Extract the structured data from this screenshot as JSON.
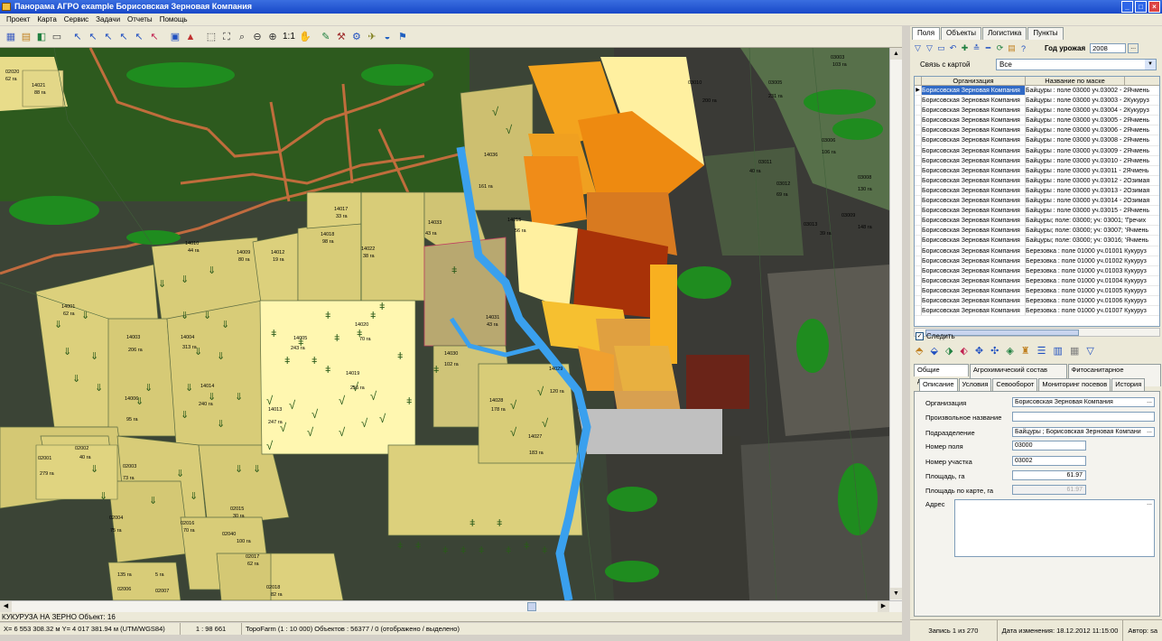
{
  "window": {
    "title": "Панорама АГРО  example   Борисовская Зерновая Компания",
    "min": "_",
    "max": "□",
    "close": "×"
  },
  "menu": [
    "Проект",
    "Карта",
    "Сервис",
    "Задачи",
    "Отчеты",
    "Помощь"
  ],
  "toolbar": {
    "scale_label": "1:1"
  },
  "map": {
    "field_labels": [
      {
        "n": "02020",
        "a": "62 га"
      },
      {
        "n": "14021",
        "a": "88 га"
      },
      {
        "n": "14017",
        "a": "33 га"
      },
      {
        "n": "14010",
        "a": "44 га"
      },
      {
        "n": "14009",
        "a": "80 га"
      },
      {
        "n": "14012",
        "a": "19 га"
      },
      {
        "n": "14018",
        "a": "98 га"
      },
      {
        "n": "14022",
        "a": "38 га"
      },
      {
        "n": "14001",
        "a": "62 га"
      },
      {
        "n": "14003",
        "a": "206 га"
      },
      {
        "n": "14006",
        "a": "95 га"
      },
      {
        "n": "14004",
        "a": "313 га"
      },
      {
        "n": "14005",
        "a": "243 га"
      },
      {
        "n": "14020",
        "a": "70 га"
      },
      {
        "n": "14019",
        "a": "256 га"
      },
      {
        "n": "14013",
        "a": "247 га"
      },
      {
        "n": "14014",
        "a": "240 га"
      },
      {
        "n": "14031",
        "a": "43 га"
      },
      {
        "n": "14030",
        "a": "102 га"
      },
      {
        "n": "14028",
        "a": "178 га"
      },
      {
        "n": "14029",
        "a": "120 га"
      },
      {
        "n": "14027",
        "a": "183 га"
      },
      {
        "n": "02001",
        "a": "279 га"
      },
      {
        "n": "02002",
        "a": "40 га"
      },
      {
        "n": "02003",
        "a": "73 га"
      },
      {
        "n": "02004",
        "a": "75 га"
      },
      {
        "n": "02016",
        "a": "70 га"
      },
      {
        "n": "02015",
        "a": "30 га"
      },
      {
        "n": "02040",
        "a": "100 га"
      },
      {
        "n": "02017",
        "a": "62 га"
      },
      {
        "n": "02006",
        "a": "135 га"
      },
      {
        "n": "02007",
        "a": "5 га"
      },
      {
        "n": "02018",
        "a": "82 га"
      },
      {
        "n": "03010",
        "a": "200 га"
      },
      {
        "n": "03005",
        "a": "231 га"
      },
      {
        "n": "03003",
        "a": "103 га"
      },
      {
        "n": "03006",
        "a": "106 га"
      },
      {
        "n": "03011",
        "a": "40 га"
      },
      {
        "n": "03012",
        "a": "69 га"
      },
      {
        "n": "03008",
        "a": "130 га"
      },
      {
        "n": "03009",
        "a": "148 га"
      },
      {
        "n": "03013",
        "a": "39 га"
      },
      {
        "n": "14033",
        "a": "43 га"
      },
      {
        "n": "14015",
        "a": "56 га"
      },
      {
        "n": "14036",
        "a": "161 га"
      }
    ]
  },
  "status": {
    "object_line": "КУКУРУЗА НА ЗЕРНО Объект: 16",
    "coords": "X= 6 553 308.32 м  Y= 4 017 381.94 м  (UTM/WGS84)",
    "scale": "1 : 98 661",
    "layer": "TopoFarm (1 : 10 000)  Объектов : 56377 / 0 (отображено / выделено)"
  },
  "panel": {
    "tabs": [
      "Поля",
      "Объекты",
      "Логистика",
      "Пункты"
    ],
    "year_label": "Год урожая",
    "year_value": "2008",
    "dots": "...",
    "link_label": "Связь с картой",
    "link_value": "Все",
    "grid_headers": [
      "Организация",
      "Название по маске"
    ],
    "rows": [
      {
        "org": "Борисовская Зерновая Компания",
        "name": "Байцуры : поле 03000 уч.03002 - 2Ячмень"
      },
      {
        "org": "Борисовская Зерновая Компания",
        "name": "Байцуры : поле 03000 уч.03003 - 2Кукуруз"
      },
      {
        "org": "Борисовская Зерновая Компания",
        "name": "Байцуры : поле 03000 уч.03004 - 2Кукуруз"
      },
      {
        "org": "Борисовская Зерновая Компания",
        "name": "Байцуры : поле 03000 уч.03005 - 2Ячмень"
      },
      {
        "org": "Борисовская Зерновая Компания",
        "name": "Байцуры : поле 03000 уч.03006 - 2Ячмень"
      },
      {
        "org": "Борисовская Зерновая Компания",
        "name": "Байцуры : поле 03000 уч.03008 - 2Ячмень"
      },
      {
        "org": "Борисовская Зерновая Компания",
        "name": "Байцуры : поле 03000 уч.03009 - 2Ячмень"
      },
      {
        "org": "Борисовская Зерновая Компания",
        "name": "Байцуры : поле 03000 уч.03010 - 2Ячмень"
      },
      {
        "org": "Борисовская Зерновая Компания",
        "name": "Байцуры : поле 03000 уч.03011 - 2Ячмень"
      },
      {
        "org": "Борисовская Зерновая Компания",
        "name": "Байцуры : поле 03000 уч.03012 - 2Озимая"
      },
      {
        "org": "Борисовская Зерновая Компания",
        "name": "Байцуры : поле 03000 уч.03013 - 2Озимая"
      },
      {
        "org": "Борисовская Зерновая Компания",
        "name": "Байцуры : поле 03000 уч.03014 - 2Озимая"
      },
      {
        "org": "Борисовская Зерновая Компания",
        "name": "Байцуры : поле 03000 уч.03015 - 2Ячмень"
      },
      {
        "org": "Борисовская Зерновая Компания",
        "name": "Байцуры; поле: 03000; уч: 03001; 'Гречих"
      },
      {
        "org": "Борисовская Зерновая Компания",
        "name": "Байцуры; поле: 03000; уч: 03007; 'Ячмень"
      },
      {
        "org": "Борисовская Зерновая Компания",
        "name": "Байцуры; поле: 03000; уч: 03016; 'Ячмень"
      },
      {
        "org": "Борисовская Зерновая Компания",
        "name": "Березовка : поле 01000 уч.01001 Кукуруз"
      },
      {
        "org": "Борисовская Зерновая Компания",
        "name": "Березовка : поле 01000 уч.01002 Кукуруз"
      },
      {
        "org": "Борисовская Зерновая Компания",
        "name": "Березовка : поле 01000 уч.01003 Кукуруз"
      },
      {
        "org": "Борисовская Зерновая Компания",
        "name": "Березовка : поле 01000 уч.01004 Кукуруз"
      },
      {
        "org": "Борисовская Зерновая Компания",
        "name": "Березовка : поле 01000 уч.01005 Кукуруз"
      },
      {
        "org": "Борисовская Зерновая Компания",
        "name": "Березовка : поле 01000 уч.01006 Кукуруз"
      },
      {
        "org": "Борисовская Зерновая Компания",
        "name": "Березовка : поле 01000 уч.01007 Кукуруз"
      }
    ],
    "follow_label": "Следить",
    "subtabs": [
      "Общие данные",
      "Агрохимический состав почв",
      "Фитосанитарное состояние"
    ],
    "subtabs2": [
      "Описание",
      "Условия",
      "Севооборот",
      "Мониторинг посевов",
      "История"
    ],
    "form": {
      "org_label": "Организация",
      "org_value": "Борисовская Зерновая Компания",
      "custom_label": "Произвольное название",
      "custom_value": "",
      "division_label": "Подразделение",
      "division_value": "Байцуры ; Борисовская Зерновая Компани",
      "field_no_label": "Номер поля",
      "field_no_value": "03000",
      "plot_no_label": "Номер участка",
      "plot_no_value": "03002",
      "area_label": "Площадь, га",
      "area_value": "61.97",
      "map_area_label": "Площадь по карте, га",
      "map_area_value": "61.97",
      "address_label": "Адрес",
      "address_value": ""
    },
    "footer": {
      "records": "Запись 1 из 270",
      "changed": "Дата изменения: 18.12.2012 11:15:00",
      "author": "Автор: sa"
    }
  }
}
